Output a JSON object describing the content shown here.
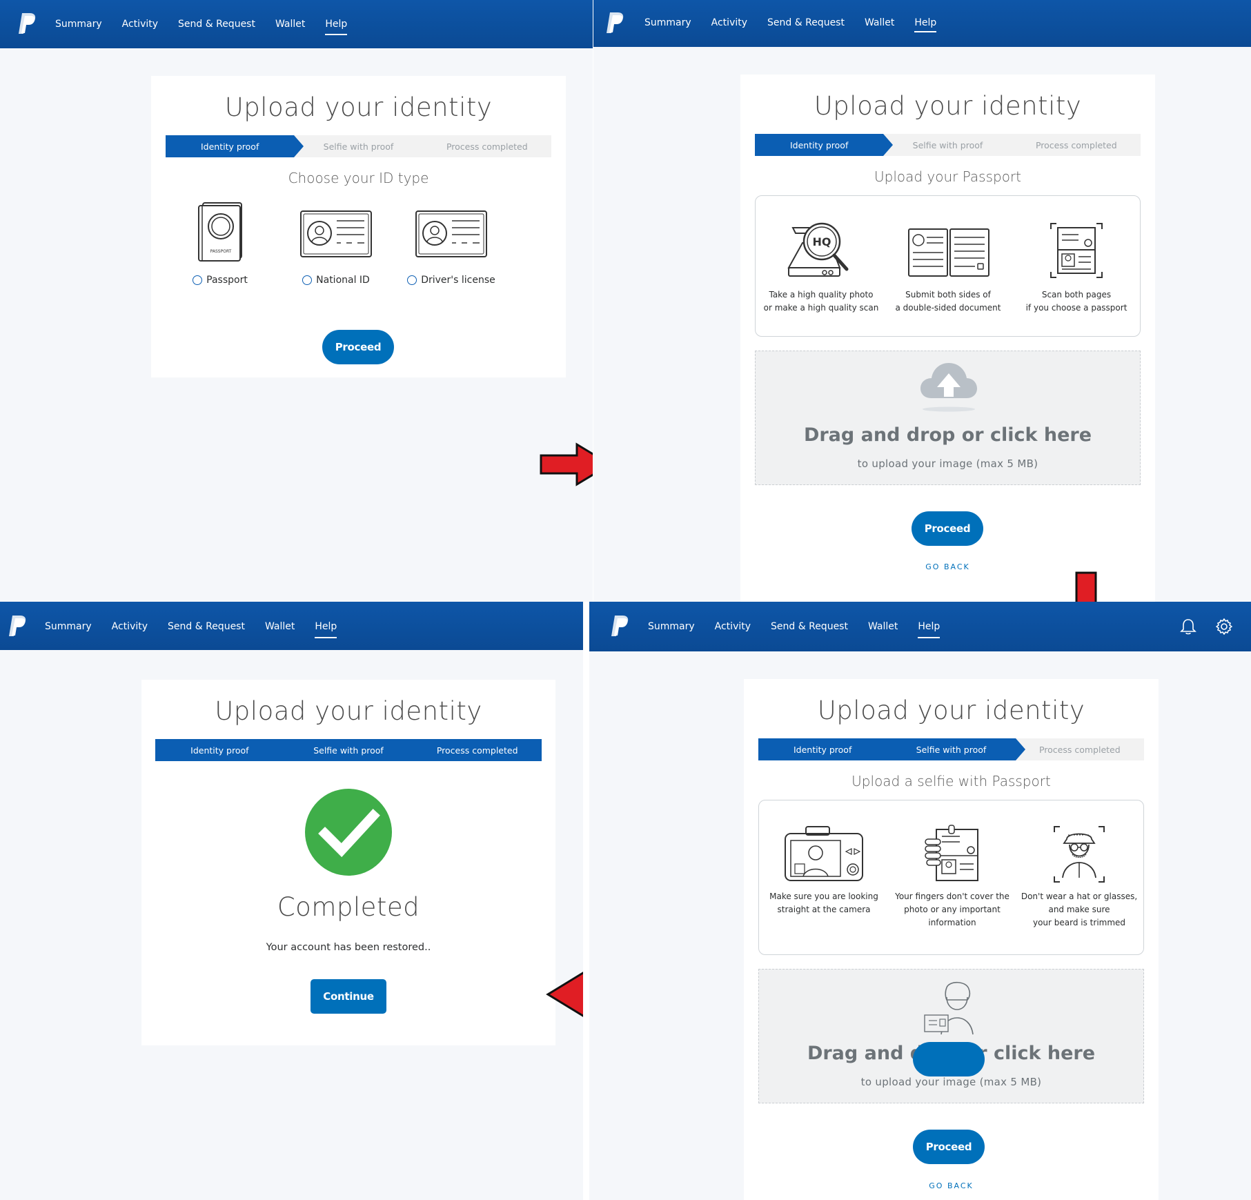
{
  "nav": {
    "items": [
      "Summary",
      "Activity",
      "Send & Request",
      "Wallet",
      "Help"
    ],
    "active": "Help"
  },
  "colors": {
    "nav_blue": "#0b4a94",
    "accent": "#0070ba",
    "step_active": "#0b5eb3",
    "success_green": "#3fae49",
    "arrow_red": "#e01e24"
  },
  "title": "Upload your identity",
  "steps": [
    "Identity proof",
    "Selfie with proof",
    "Process completed"
  ],
  "screen1": {
    "subheading": "Choose your ID type",
    "options": [
      {
        "label": "Passport",
        "icon": "passport-icon"
      },
      {
        "label": "National ID",
        "icon": "id-card-icon"
      },
      {
        "label": "Driver's license",
        "icon": "license-icon"
      }
    ],
    "passport_text": "PASSPORT",
    "proceed": "Proceed"
  },
  "screen2": {
    "subheading": "Upload your Passport",
    "tips": [
      {
        "line1": "Take a high quality photo",
        "line2": "or make a high quality scan",
        "icon": "hq-magnifier-icon",
        "badge": "HQ"
      },
      {
        "line1": "Submit both sides of",
        "line2": "a double-sided document",
        "icon": "two-sided-document-icon"
      },
      {
        "line1": "Scan both pages",
        "line2": "if you choose a passport",
        "icon": "scan-pages-icon"
      }
    ],
    "drop_title": "Drag and drop or click here",
    "drop_sub": "to upload your image (max 5 MB)",
    "proceed": "Proceed",
    "go_back": "GO BACK"
  },
  "screen3": {
    "heading": "Completed",
    "message": "Your account has been restored..",
    "continue": "Continue"
  },
  "screen4": {
    "subheading": "Upload a selfie with Passport",
    "tips": [
      {
        "line1": "Make sure you are looking",
        "line2": "straight at the camera",
        "line3": "",
        "icon": "camera-selfie-icon"
      },
      {
        "line1": "Your fingers don't cover the",
        "line2": "photo or any important",
        "line3": "information",
        "icon": "hand-holding-id-icon"
      },
      {
        "line1": "Don't wear a hat or glasses,",
        "line2": "and make sure",
        "line3": "your beard is trimmed",
        "icon": "man-with-hat-icon"
      }
    ],
    "drop_title": "Drag and drop or click here",
    "drop_sub": "to upload your image (max 5 MB)",
    "proceed": "Proceed",
    "go_back": "GO BACK"
  }
}
